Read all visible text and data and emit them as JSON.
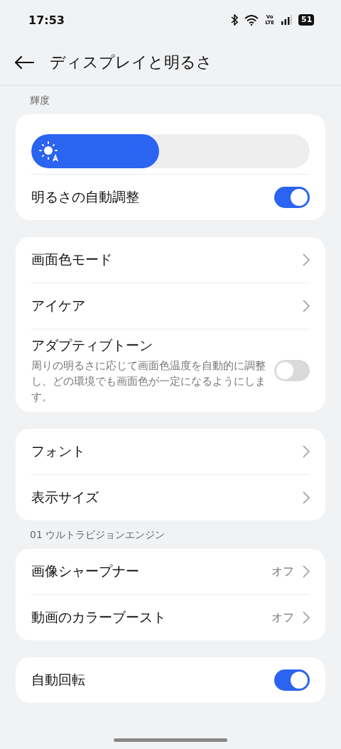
{
  "status_bar": {
    "time": "17:53",
    "network_top": "Vo",
    "network_bottom": "LTE",
    "battery": "51"
  },
  "header": {
    "title": "ディスプレイと明るさ"
  },
  "sections": [
    {
      "label": "輝度",
      "items": [
        {
          "kind": "slider",
          "level": 0.46
        },
        {
          "kind": "switch",
          "title": "明るさの自動調整",
          "on": true
        }
      ]
    },
    {
      "items": [
        {
          "kind": "link",
          "title": "画面色モード"
        },
        {
          "kind": "link",
          "title": "アイケア"
        },
        {
          "kind": "switch",
          "title": "アダプティブトーン",
          "description": "周りの明るさに応じて画面色温度を自動的に調整し、どの環境でも画面色が一定になるようにします。",
          "on": false
        }
      ]
    },
    {
      "items": [
        {
          "kind": "link",
          "title": "フォント"
        },
        {
          "kind": "link",
          "title": "表示サイズ"
        }
      ]
    },
    {
      "label": "01 ウルトラビジョンエンジン",
      "items": [
        {
          "kind": "link",
          "title": "画像シャープナー",
          "value": "オフ"
        },
        {
          "kind": "link",
          "title": "動画のカラーブースト",
          "value": "オフ"
        }
      ]
    },
    {
      "items": [
        {
          "kind": "switch",
          "title": "自動回転",
          "on": true
        }
      ]
    }
  ]
}
